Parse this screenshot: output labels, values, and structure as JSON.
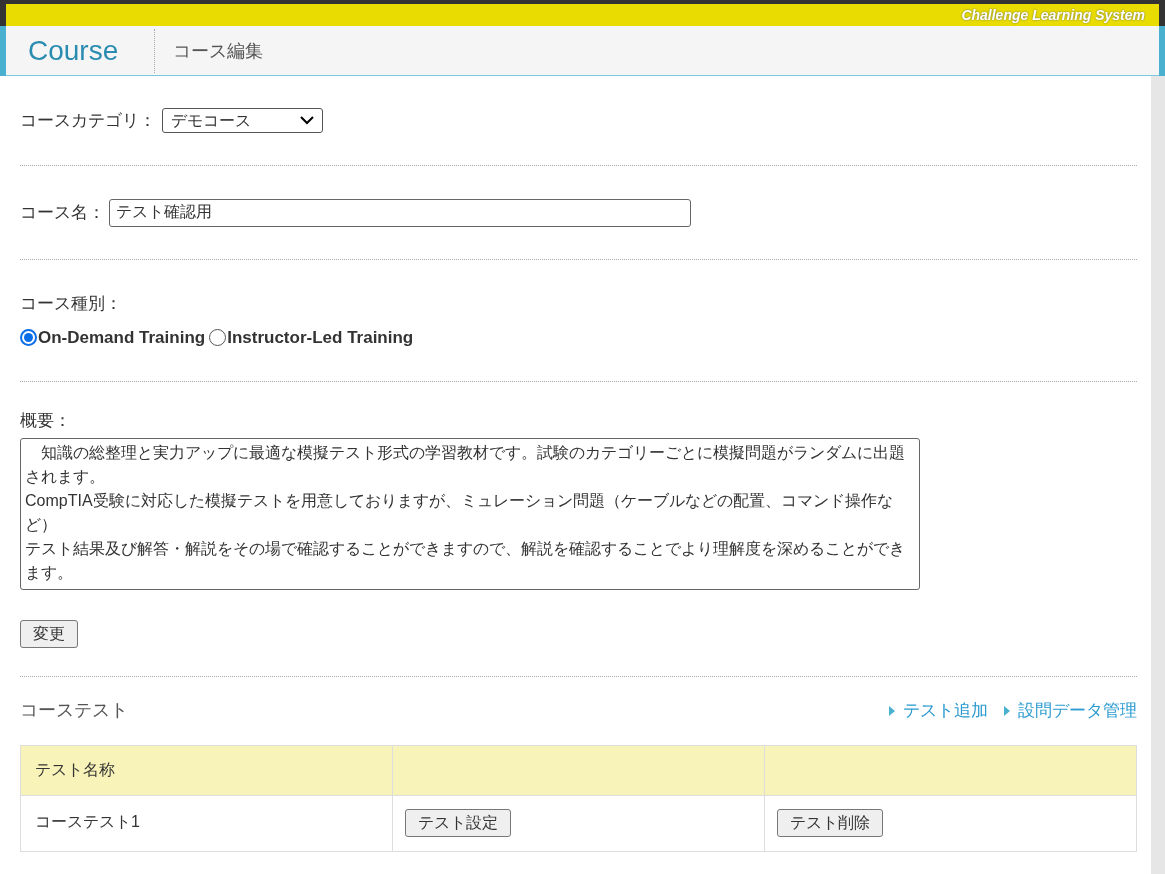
{
  "brand": "Challenge Learning System",
  "header": {
    "section": "Course",
    "title": "コース編集"
  },
  "category": {
    "label": "コースカテゴリ：",
    "value": "デモコース"
  },
  "course_name": {
    "label": "コース名：",
    "value": "テスト確認用"
  },
  "course_type": {
    "label": "コース種別：",
    "options": [
      {
        "label": "On-Demand Training",
        "selected": true
      },
      {
        "label": "Instructor-Led Training",
        "selected": false
      }
    ]
  },
  "summary": {
    "label": "概要：",
    "paragraphs": [
      "　知識の総整理と実力アップに最適な模擬テスト形式の学習教材です。試験のカテゴリーごとに模擬問題がランダムに出題されます。",
      "CompTIA受験に対応した模擬テストを用意しておりますが、ミュレーション問題（ケーブルなどの配置、コマンド操作など）",
      "テスト結果及び解答・解説をその場で確認することができますので、解説を確認することでより理解度を深めることができます。"
    ]
  },
  "save_button": "変更",
  "tests": {
    "title": "コーステスト",
    "links": [
      "テスト追加",
      "設問データ管理"
    ],
    "columns": [
      "テスト名称"
    ],
    "rows": [
      {
        "name": "コーステスト1",
        "settings_button": "テスト設定",
        "delete_button": "テスト削除"
      }
    ]
  }
}
